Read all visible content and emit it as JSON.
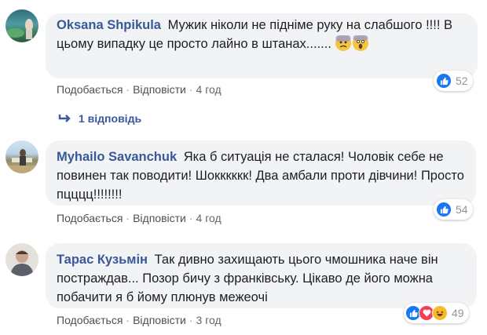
{
  "actions": {
    "like": "Подобається",
    "reply": "Відповісти",
    "sep": "·"
  },
  "comments": [
    {
      "author": "Oksana Shpikula",
      "text": "Мужик ніколи не підніме руку на слабшого !!!! В цьому випадку це просто лайно в штанах.......",
      "emoji": [
        "fearful-face-emoji",
        "screaming-face-emoji"
      ],
      "time": "4 год",
      "reactions": [
        "like-icon"
      ],
      "reaction_count": "52"
    },
    {
      "author": "Myhailo Savanchuk",
      "text": "Яка б ситуація не сталася! Чоловік себе не повинен так поводити! Шокккккк! Два амбали проти дівчини! Просто пцццц!!!!!!!!",
      "time": "4 год",
      "reactions": [
        "like-icon"
      ],
      "reaction_count": "54"
    },
    {
      "author": "Тарас Кузьмін",
      "text": "Так дивно захищають цього чмошника наче він постраждав... Позор бичу з франківську. Цікаво де його можна побачити я б йому плюнув межеочі",
      "time": "3 год",
      "reactions": [
        "like-icon",
        "love-icon",
        "haha-icon"
      ],
      "reaction_count": "49"
    }
  ],
  "replies_link": "1 відповідь",
  "colors": {
    "link": "#385898",
    "bubble": "#f2f3f5",
    "like": "#1877f2",
    "love": "#f33e58",
    "haha": "#f7b928"
  }
}
